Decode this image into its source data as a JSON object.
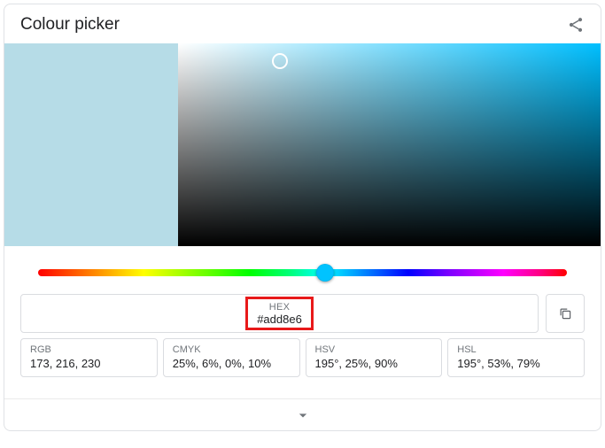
{
  "title": "Colour picker",
  "selected_color": "#b6dce7",
  "gradient_base_hue": 195,
  "hex": {
    "label": "HEX",
    "value": "#add8e6"
  },
  "copy_icon": "copy",
  "share_icon": "share",
  "expand_icon": "chevron-down",
  "formats": {
    "rgb": {
      "label": "RGB",
      "value": "173, 216, 230"
    },
    "cmyk": {
      "label": "CMYK",
      "value": "25%, 6%, 0%, 10%"
    },
    "hsv": {
      "label": "HSV",
      "value": "195°, 25%, 90%"
    },
    "hsl": {
      "label": "HSL",
      "value": "195°, 53%, 79%"
    }
  }
}
